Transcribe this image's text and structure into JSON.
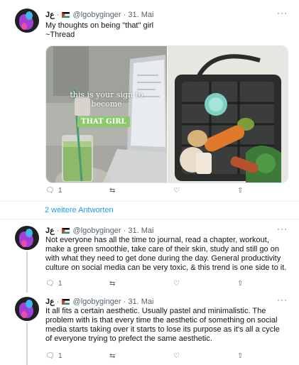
{
  "user": {
    "name": "Jع",
    "handle": "@lgobyginger"
  },
  "tweets": [
    {
      "date": "31. Mai",
      "text_lines": [
        "My thoughts on being \"that\" girl",
        "~Thread"
      ],
      "reply_count": "1"
    },
    {
      "date": "31. Mai",
      "text": "Not everyone has all the time to journal, read a chapter, workout, make a green smoothie, take care of their skin, study and still go on with what they need to get done during the day. General productivity culture on social media can be very toxic, & this trend is one side to it.",
      "reply_count": "1"
    },
    {
      "date": "31. Mai",
      "text": "It all fits a certain aesthetic. Usually pastel and minimalistic. The problem with is that every time the aesthetic of something on social media starts taking over it starts to lose its purpose as it's all a cycle of everyone trying to prefect the same aesthetic.",
      "reply_count": "1"
    }
  ],
  "media": {
    "overlay_lines": [
      "this is your sign to",
      "become"
    ],
    "badge": "THAT GIRL"
  },
  "show_more": "2 weitere Antworten",
  "icons": [
    "reply-icon",
    "retweet-icon",
    "like-icon",
    "share-icon",
    "more-icon"
  ],
  "colors": {
    "link": "#1d9bf0",
    "secondary": "#536471"
  }
}
